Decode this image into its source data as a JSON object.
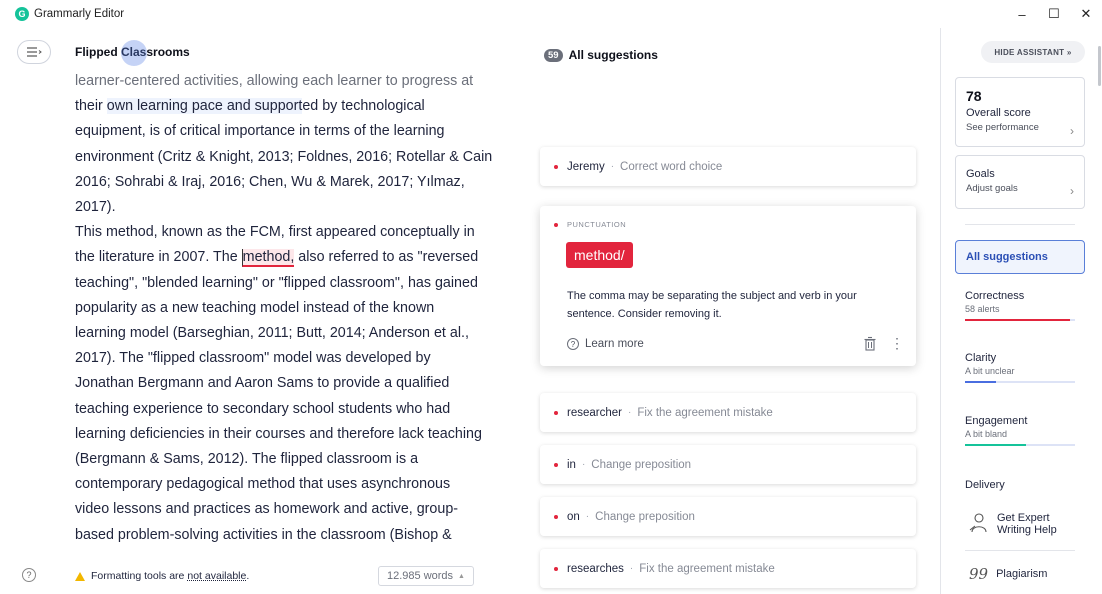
{
  "window": {
    "title": "Grammarly Editor",
    "logo_letter": "G",
    "minimize": "–",
    "maximize": "☐",
    "close": "✕"
  },
  "editor": {
    "doc_title": "Flipped Classrooms",
    "lines": [
      "learner-centered activities, allowing each learner to progress at",
      "their own learning pace and supported by technological",
      "equipment, is of critical importance in terms of the learning",
      "environment (Critz & Knight, 2013; Foldnes, 2016; Rotellar & Cain",
      "2016; Sohrabi & Iraj, 2016; Chen, Wu & Marek, 2017; Yılmaz,",
      "2017).",
      "This method, known as the FCM, first appeared conceptually in",
      "the literature in 2007. The ",
      "teaching\", \"blended learning\" or \"flipped classroom\", has gained",
      "popularity as a new teaching model instead of the known",
      "learning model (Barseghian, 2011; Butt, 2014; Anderson et al.,",
      "2017). The \"flipped classroom\" model was developed by",
      "Jonathan Bergmann and Aaron Sams to provide a qualified",
      "teaching experience to secondary school students who had",
      "learning deficiencies in their courses and therefore lack teaching",
      "(Bergmann & Sams, 2012). The flipped classroom is a",
      "contemporary pedagogical method that uses asynchronous",
      "video lessons and practices as homework and active, group-",
      "based problem-solving activities in the classroom (Bishop &"
    ],
    "line2_pre": "their ",
    "line2_hl": "own learning pace and support",
    "line2_post": "ed by technological",
    "line8_pre": "the literature in 2007. The ",
    "line8_err": "method,",
    "line8_post": " also referred to as \"reversed",
    "format_warning": "Formatting tools are",
    "format_link": "not available",
    "format_period": ".",
    "word_count": "12.985 words",
    "help": "?"
  },
  "suggestions": {
    "count": "59",
    "title": "All suggestions",
    "collapsed": [
      {
        "word": "Jeremy",
        "desc": "Correct word choice"
      },
      {
        "word": "researcher",
        "desc": "Fix the agreement mistake"
      },
      {
        "word": "in",
        "desc": "Change preposition"
      },
      {
        "word": "on",
        "desc": "Change preposition"
      },
      {
        "word": "researches",
        "desc": "Fix the agreement mistake"
      }
    ],
    "expanded": {
      "category": "PUNCTUATION",
      "replacement": "method/",
      "text": "The comma may be separating the subject and verb in your sentence. Consider removing it.",
      "learn_more": "Learn more"
    },
    "separator": "·"
  },
  "assistant": {
    "hide_label": "HIDE ASSISTANT  »",
    "score": "78",
    "score_label": "Overall score",
    "score_link": "See performance",
    "goals_title": "Goals",
    "goals_link": "Adjust goals",
    "all_suggestions": "All suggestions",
    "categories": [
      {
        "name": "Correctness",
        "sub": "58 alerts",
        "fill": 0.95,
        "color": "#e2253d"
      },
      {
        "name": "Clarity",
        "sub": "A bit unclear",
        "fill": 0.28,
        "color": "#4a6ee0"
      },
      {
        "name": "Engagement",
        "sub": "A bit bland",
        "fill": 0.55,
        "color": "#15c39a"
      }
    ],
    "delivery": "Delivery",
    "expert_line1": "Get Expert",
    "expert_line2": "Writing Help",
    "plagiarism": "Plagiarism",
    "chevron": "›"
  }
}
